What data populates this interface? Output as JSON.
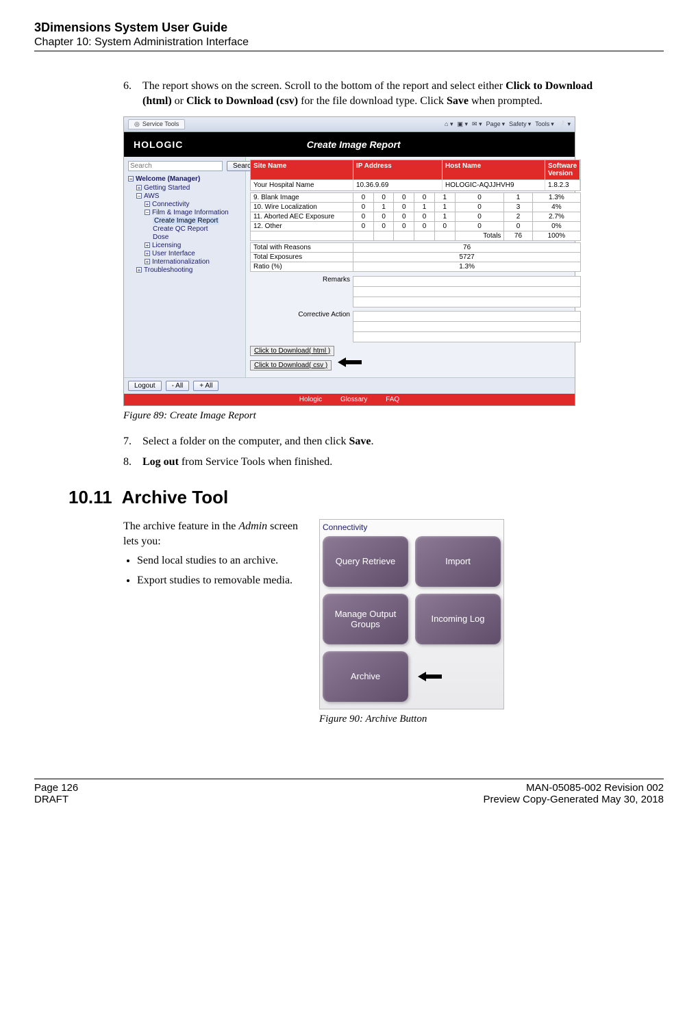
{
  "header": {
    "doc_title": "3Dimensions System User Guide",
    "chapter": "Chapter 10: System Administration Interface"
  },
  "steps_a": {
    "s6": {
      "num": "6.",
      "pre": "The report shows on the screen. Scroll to the bottom of the report and select either ",
      "b1": "Click to Download (html)",
      "mid1": " or ",
      "b2": "Click to Download (csv)",
      "mid2": " for the file download type. Click ",
      "b3": "Save",
      "post": " when prompted."
    },
    "s7": {
      "num": "7.",
      "pre": "Select a folder on the computer, and then click ",
      "b1": "Save",
      "post": "."
    },
    "s8": {
      "num": "8.",
      "b1": "Log out",
      "post": " from Service Tools when finished."
    }
  },
  "fig89": {
    "caption": "Figure 89: Create Image Report",
    "ie_tab": "Service Tools",
    "ie_actions": {
      "page": "Page",
      "safety": "Safety",
      "tools": "Tools"
    },
    "brand": "HOLOGIC",
    "title": "Create Image Report",
    "search_placeholder": "Search",
    "search_btn": "Search",
    "tree": {
      "root": "Welcome (Manager)",
      "items": [
        "Getting Started",
        "AWS",
        "Connectivity",
        "Film & Image Information",
        "Create Image Report",
        "Create QC Report",
        "Dose",
        "Licensing",
        "User Interface",
        "Internationalization",
        "Troubleshooting"
      ]
    },
    "headers": {
      "site": "Site Name",
      "ip": "IP Address",
      "host": "Host Name",
      "sw": "Software Version"
    },
    "subrow": {
      "site": "Your Hospital Name",
      "ip": "10.36.9.69",
      "host": "HOLOGIC-AQJJHVH9",
      "sw": "1.8.2.3"
    },
    "rows": [
      {
        "label": "9. Blank Image",
        "c": [
          "0",
          "0",
          "0",
          "0",
          "1",
          "0",
          "1",
          "1.3%"
        ]
      },
      {
        "label": "10. Wire Localization",
        "c": [
          "0",
          "1",
          "0",
          "1",
          "1",
          "0",
          "3",
          "4%"
        ]
      },
      {
        "label": "11. Aborted AEC Exposure",
        "c": [
          "0",
          "0",
          "0",
          "0",
          "1",
          "0",
          "2",
          "2.7%"
        ]
      },
      {
        "label": "12. Other",
        "c": [
          "0",
          "0",
          "0",
          "0",
          "0",
          "0",
          "0",
          "0%"
        ]
      }
    ],
    "totals_row": {
      "label": "Totals",
      "v1": "76",
      "v2": "100%"
    },
    "summary": [
      {
        "k": "Total with Reasons",
        "v": "76"
      },
      {
        "k": "Total Exposures",
        "v": "5727"
      },
      {
        "k": "Ratio (%)",
        "v": "1.3%"
      }
    ],
    "remarks_label": "Remarks",
    "corrective_label": "Corrective Action",
    "dl_html": "Click to Download( html )",
    "dl_csv": "Click to Download( csv )",
    "btn_logout": "Logout",
    "btn_all": "- All",
    "btn_plus": "+ All",
    "foot": {
      "a": "Hologic",
      "b": "Glossary",
      "c": "FAQ"
    }
  },
  "section": {
    "num": "10.11",
    "title": "Archive Tool"
  },
  "archive": {
    "intro_pre": "The archive feature in the ",
    "intro_i": "Admin",
    "intro_post": " screen lets you:",
    "b1": "Send local studies to an archive.",
    "b2": "Export studies to removable media."
  },
  "fig90": {
    "caption": "Figure 90: Archive Button",
    "group": "Connectivity",
    "buttons": {
      "qr": "Query Retrieve",
      "import": "Import",
      "groups": "Manage Output Groups",
      "log": "Incoming Log",
      "archive": "Archive"
    }
  },
  "footer": {
    "page": "Page 126",
    "draft": "DRAFT",
    "man": "MAN-05085-002 Revision 002",
    "preview": "Preview Copy-Generated May 30, 2018"
  }
}
